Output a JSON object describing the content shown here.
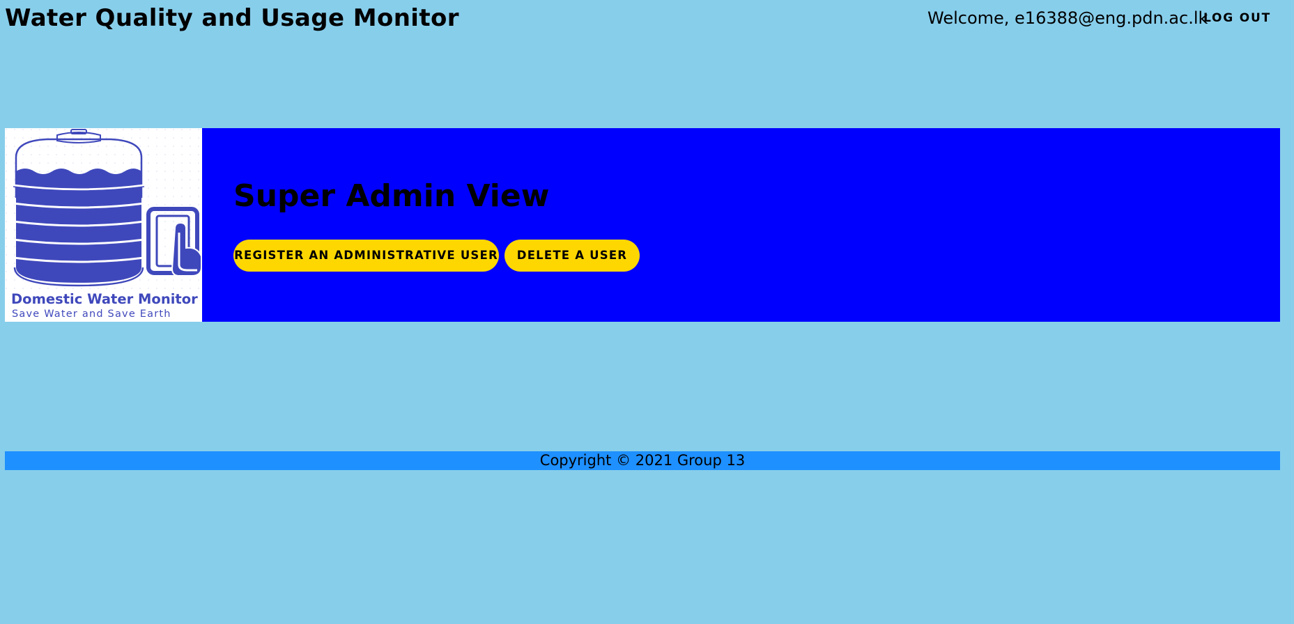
{
  "header": {
    "app_title": "Water Quality and Usage Monitor",
    "welcome_text": "Welcome, e16388@eng.pdn.ac.lk",
    "logout_label": "LOG OUT"
  },
  "banner": {
    "logo": {
      "title": "Domestic Water Monitor",
      "subtitle": "Save Water and Save Earth",
      "icon": "water-tank-with-hand-icon"
    },
    "view_title": "Super Admin View",
    "buttons": {
      "register_label": "REGISTER AN ADMINISTRATIVE USER",
      "delete_label": "DELETE A USER"
    }
  },
  "footer": {
    "copyright": "Copyright © 2021 Group 13"
  },
  "colors": {
    "page_background": "#87CEEB",
    "banner_background": "#0000FF",
    "button_background": "#FFD700",
    "footer_background": "#1E90FF",
    "logo_accent": "#3F48BB"
  }
}
